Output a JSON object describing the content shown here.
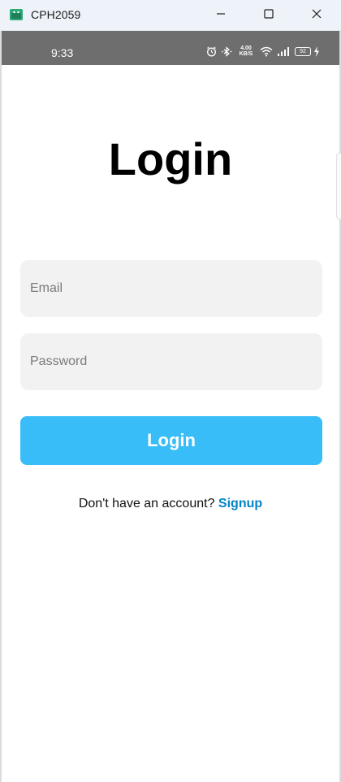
{
  "window": {
    "title": "CPH2059",
    "icon": "android-emulator-icon",
    "controls": [
      "minimize-icon",
      "maximize-icon",
      "close-icon"
    ]
  },
  "status_bar": {
    "time": "9:33",
    "net_speed_value": "4.00",
    "net_speed_unit": "KB/S",
    "battery": "92",
    "icons": [
      "alarm-icon",
      "bluetooth-icon",
      "wifi-icon",
      "signal-icon",
      "battery-icon",
      "charging-icon"
    ]
  },
  "login": {
    "title": "Login",
    "email_placeholder": "Email",
    "email_value": "",
    "password_placeholder": "Password",
    "password_value": "",
    "button_label": "Login",
    "signup_prompt": "Don't have an account?",
    "signup_link": "Signup"
  },
  "colors": {
    "accent": "#38bdf8",
    "link": "#0284c7",
    "field_bg": "#f2f2f2",
    "status_bar_bg": "#6e6e6e",
    "titlebar_bg": "#eef3f9"
  }
}
